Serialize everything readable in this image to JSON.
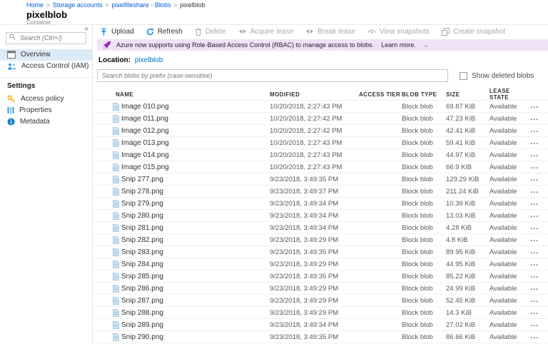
{
  "breadcrumb": {
    "items": [
      "Home",
      "Storage accounts",
      "pixelfileshare - Blobs"
    ],
    "current": "pixelblob",
    "separator": ">"
  },
  "header": {
    "title": "pixelblob",
    "subtitle": "Container"
  },
  "sidebar": {
    "collapse_glyph": "«",
    "search_placeholder": "Search (Ctrl+/)",
    "items": [
      {
        "label": "Overview"
      },
      {
        "label": "Access Control (IAM)"
      }
    ],
    "settings_header": "Settings",
    "settings_items": [
      {
        "label": "Access policy"
      },
      {
        "label": "Properties"
      },
      {
        "label": "Metadata"
      }
    ]
  },
  "toolbar": {
    "buttons": [
      {
        "label": "Upload",
        "enabled": true
      },
      {
        "label": "Refresh",
        "enabled": true
      },
      {
        "label": "Delete",
        "enabled": false
      },
      {
        "label": "Acquire lease",
        "enabled": false
      },
      {
        "label": "Break lease",
        "enabled": false
      },
      {
        "label": "View snapshots",
        "enabled": false
      },
      {
        "label": "Create snapshot",
        "enabled": false
      }
    ]
  },
  "banner": {
    "text": "Azure now supports using Role-Based Access Control (RBAC) to manage access to blobs.",
    "link_text": "Learn more.",
    "arrow": "→"
  },
  "location": {
    "label": "Location:",
    "value": "pixelblob"
  },
  "filters": {
    "search_placeholder": "Search blobs by prefix (case-sensitive)",
    "show_deleted_label": "Show deleted blobs",
    "show_deleted_checked": false
  },
  "table": {
    "columns": {
      "name": "NAME",
      "modified": "MODIFIED",
      "access_tier": "ACCESS TIER",
      "blob_type": "BLOB TYPE",
      "size": "SIZE",
      "lease_state": "LEASE STATE"
    },
    "rows": [
      {
        "name": "Image 010.png",
        "modified": "10/20/2018, 2:27:43 PM",
        "access_tier": "",
        "blob_type": "Block blob",
        "size": "69.87 KiB",
        "lease_state": "Available"
      },
      {
        "name": "Image 011.png",
        "modified": "10/20/2018, 2:27:42 PM",
        "access_tier": "",
        "blob_type": "Block blob",
        "size": "47.23 KiB",
        "lease_state": "Available"
      },
      {
        "name": "Image 012.png",
        "modified": "10/20/2018, 2:27:42 PM",
        "access_tier": "",
        "blob_type": "Block blob",
        "size": "42.41 KiB",
        "lease_state": "Available"
      },
      {
        "name": "Image 013.png",
        "modified": "10/20/2018, 2:27:43 PM",
        "access_tier": "",
        "blob_type": "Block blob",
        "size": "59.41 KiB",
        "lease_state": "Available"
      },
      {
        "name": "Image 014.png",
        "modified": "10/20/2018, 2:27:43 PM",
        "access_tier": "",
        "blob_type": "Block blob",
        "size": "44.97 KiB",
        "lease_state": "Available"
      },
      {
        "name": "Image 015.png",
        "modified": "10/20/2018, 2:27:43 PM",
        "access_tier": "",
        "blob_type": "Block blob",
        "size": "66.9 KiB",
        "lease_state": "Available"
      },
      {
        "name": "Snip 277.png",
        "modified": "9/23/2018, 3:49:35 PM",
        "access_tier": "",
        "blob_type": "Block blob",
        "size": "129.29 KiB",
        "lease_state": "Available"
      },
      {
        "name": "Snip 278.png",
        "modified": "9/23/2018, 3:49:37 PM",
        "access_tier": "",
        "blob_type": "Block blob",
        "size": "211.24 KiB",
        "lease_state": "Available"
      },
      {
        "name": "Snip 279.png",
        "modified": "9/23/2018, 3:49:34 PM",
        "access_tier": "",
        "blob_type": "Block blob",
        "size": "10.39 KiB",
        "lease_state": "Available"
      },
      {
        "name": "Snip 280.png",
        "modified": "9/23/2018, 3:49:34 PM",
        "access_tier": "",
        "blob_type": "Block blob",
        "size": "13.03 KiB",
        "lease_state": "Available"
      },
      {
        "name": "Snip 281.png",
        "modified": "9/23/2018, 3:49:34 PM",
        "access_tier": "",
        "blob_type": "Block blob",
        "size": "4.28 KiB",
        "lease_state": "Available"
      },
      {
        "name": "Snip 282.png",
        "modified": "9/23/2018, 3:49:29 PM",
        "access_tier": "",
        "blob_type": "Block blob",
        "size": "4.8 KiB",
        "lease_state": "Available"
      },
      {
        "name": "Snip 283.png",
        "modified": "9/23/2018, 3:49:35 PM",
        "access_tier": "",
        "blob_type": "Block blob",
        "size": "89.95 KiB",
        "lease_state": "Available"
      },
      {
        "name": "Snip 284.png",
        "modified": "9/23/2018, 3:49:29 PM",
        "access_tier": "",
        "blob_type": "Block blob",
        "size": "44.95 KiB",
        "lease_state": "Available"
      },
      {
        "name": "Snip 285.png",
        "modified": "9/23/2018, 3:49:35 PM",
        "access_tier": "",
        "blob_type": "Block blob",
        "size": "85.22 KiB",
        "lease_state": "Available"
      },
      {
        "name": "Snip 286.png",
        "modified": "9/23/2018, 3:49:29 PM",
        "access_tier": "",
        "blob_type": "Block blob",
        "size": "24.99 KiB",
        "lease_state": "Available"
      },
      {
        "name": "Snip 287.png",
        "modified": "9/23/2018, 3:49:29 PM",
        "access_tier": "",
        "blob_type": "Block blob",
        "size": "52.45 KiB",
        "lease_state": "Available"
      },
      {
        "name": "Snip 288.png",
        "modified": "9/23/2018, 3:49:29 PM",
        "access_tier": "",
        "blob_type": "Block blob",
        "size": "14.3 KiB",
        "lease_state": "Available"
      },
      {
        "name": "Snip 289.png",
        "modified": "9/23/2018, 3:49:34 PM",
        "access_tier": "",
        "blob_type": "Block blob",
        "size": "27.02 KiB",
        "lease_state": "Available"
      },
      {
        "name": "Snip 290.png",
        "modified": "9/23/2018, 3:49:35 PM",
        "access_tier": "",
        "blob_type": "Block blob",
        "size": "86.66 KiB",
        "lease_state": "Available"
      }
    ]
  },
  "ui": {
    "row_menu": "..."
  },
  "colors": {
    "accent": "#0078d4",
    "link": "#015cda",
    "banner_bg": "#f0e2f7",
    "banner_accent": "#8f2bb8",
    "selected_item_bg": "#dcebf8",
    "disabled_text": "#a8a8a8"
  }
}
